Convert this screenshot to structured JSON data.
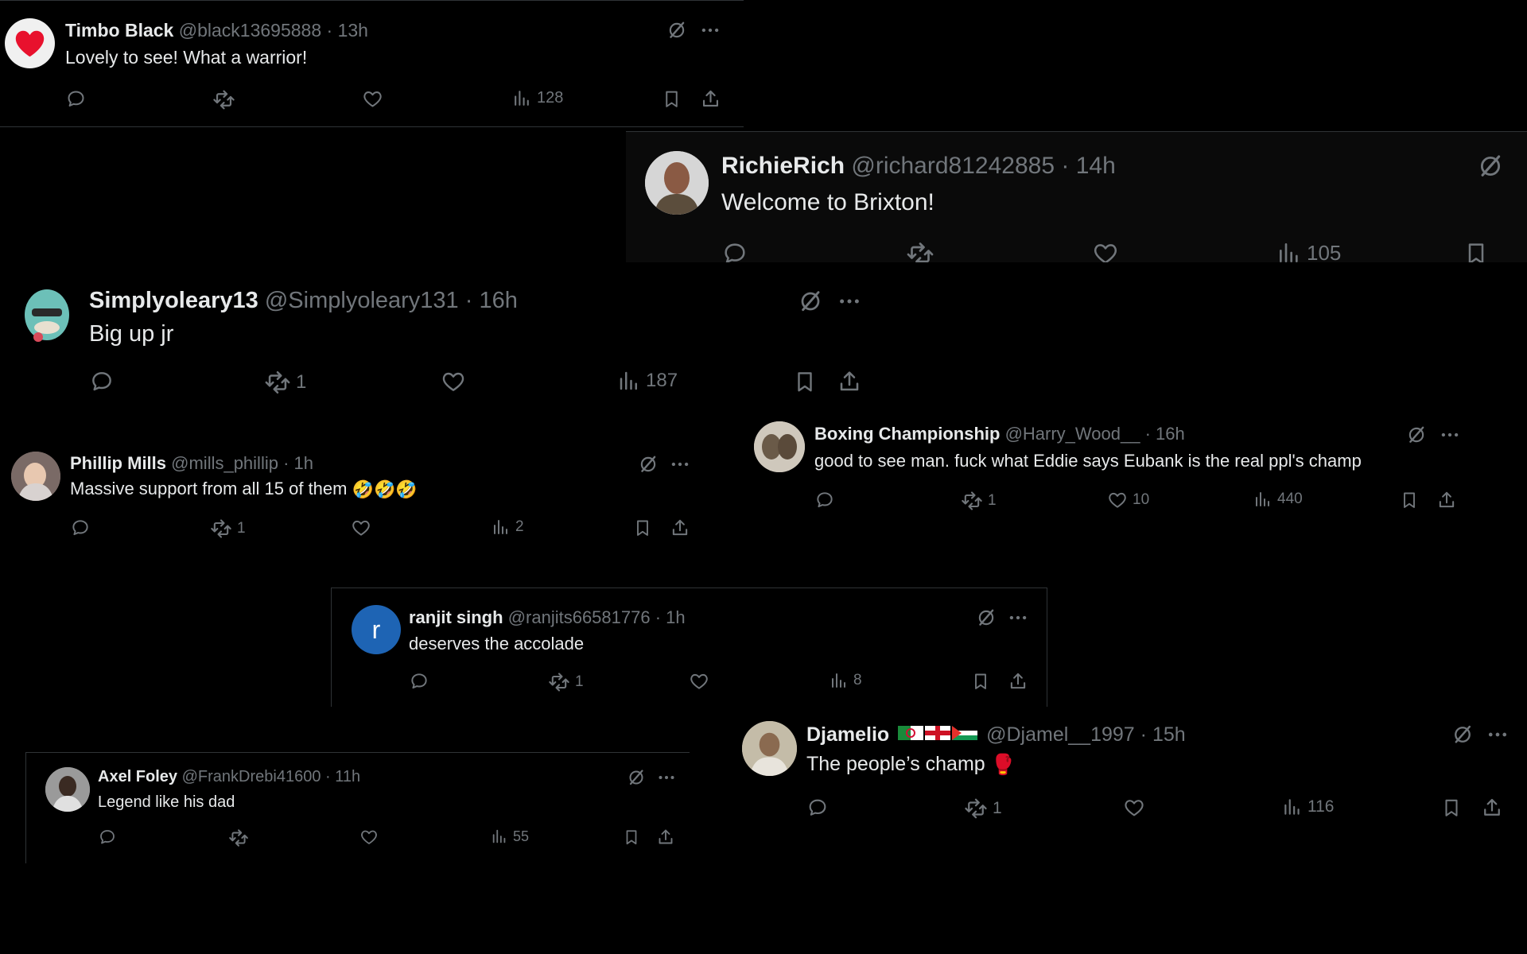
{
  "tweets": [
    {
      "id": "t1",
      "name": "Timbo Black",
      "handle": "@black13695888",
      "time": "13h",
      "text": "Lovely to see! What a warrior!",
      "retweets": "",
      "likes": "",
      "views": "128"
    },
    {
      "id": "t2",
      "name": "RichieRich",
      "handle": "@richard81242885",
      "time": "14h",
      "text": "Welcome to Brixton!",
      "retweets": "",
      "likes": "",
      "views": "105"
    },
    {
      "id": "t3",
      "name": "Simplyoleary13",
      "handle": "@Simplyoleary131",
      "time": "16h",
      "text": "Big up jr",
      "retweets": "1",
      "likes": "",
      "views": "187"
    },
    {
      "id": "t4",
      "name": "Phillip Mills",
      "handle": "@mills_phillip",
      "time": "1h",
      "text": "Massive support from all 15 of them",
      "emoji": "🤣🤣🤣",
      "retweets": "1",
      "likes": "",
      "views": "2"
    },
    {
      "id": "t5",
      "name": "Boxing Championship",
      "handle": "@Harry_Wood__",
      "time": "16h",
      "text": "good to see man. fuck what Eddie says Eubank is the real ppl's champ",
      "retweets": "1",
      "likes": "10",
      "views": "440"
    },
    {
      "id": "t6",
      "name": "ranjit singh",
      "handle": "@ranjits66581776",
      "time": "1h",
      "text": "deserves the accolade",
      "retweets": "1",
      "likes": "",
      "views": "8",
      "avatar_letter": "r"
    },
    {
      "id": "t7",
      "name": "Djamelio",
      "handle": "@Djamel__1997",
      "time": "15h",
      "text": "The people’s champ",
      "emoji": "🥊",
      "retweets": "1",
      "likes": "",
      "views": "116"
    },
    {
      "id": "t8",
      "name": "Axel Foley",
      "handle": "@FrankDrebi41600",
      "time": "11h",
      "text": "Legend like his dad",
      "retweets": "",
      "likes": "",
      "views": "55"
    }
  ],
  "sep": "·",
  "colors": {
    "background": "#000000",
    "text": "#e7e9ea",
    "muted": "#71767b",
    "border": "#2f3336",
    "avatar_blue": "#1e64b4"
  },
  "icons": [
    "reply-icon",
    "retweet-icon",
    "like-icon",
    "views-icon",
    "bookmark-icon",
    "share-icon",
    "grok-icon",
    "more-icon"
  ]
}
